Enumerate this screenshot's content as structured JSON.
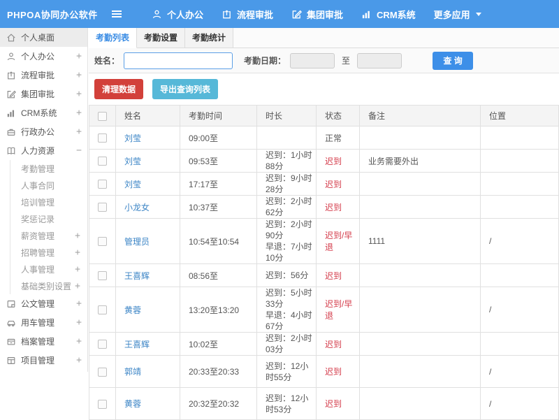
{
  "navbar": {
    "logo": "PHPOA协同办公软件",
    "items": [
      {
        "label": "个人办公",
        "icon": "user-icon"
      },
      {
        "label": "流程审批",
        "icon": "flow-icon"
      },
      {
        "label": "集团审批",
        "icon": "edit-icon"
      },
      {
        "label": "CRM系统",
        "icon": "chart-icon"
      },
      {
        "label": "更多应用",
        "icon": "caret-down-icon"
      }
    ]
  },
  "sidebar": {
    "items": [
      {
        "label": "个人桌面",
        "expand": "",
        "icon": "home-icon"
      },
      {
        "label": "个人办公",
        "expand": "+",
        "icon": "user-icon"
      },
      {
        "label": "流程审批",
        "expand": "+",
        "icon": "flow-icon"
      },
      {
        "label": "集团审批",
        "expand": "+",
        "icon": "edit-icon"
      },
      {
        "label": "CRM系统",
        "expand": "+",
        "icon": "chart-icon"
      },
      {
        "label": "行政办公",
        "expand": "+",
        "icon": "briefcase-icon"
      },
      {
        "label": "人力资源",
        "expand": "−",
        "icon": "book-icon"
      }
    ],
    "hr_children": [
      {
        "label": "考勤管理",
        "expand": ""
      },
      {
        "label": "人事合同",
        "expand": ""
      },
      {
        "label": "培训管理",
        "expand": ""
      },
      {
        "label": "奖惩记录",
        "expand": ""
      },
      {
        "label": "薪资管理",
        "expand": "+"
      },
      {
        "label": "招聘管理",
        "expand": "+"
      },
      {
        "label": "人事管理",
        "expand": "+"
      },
      {
        "label": "基础类别设置",
        "expand": "+"
      }
    ],
    "items_after": [
      {
        "label": "公文管理",
        "expand": "+",
        "icon": "doc-icon"
      },
      {
        "label": "用车管理",
        "expand": "+",
        "icon": "car-icon"
      },
      {
        "label": "档案管理",
        "expand": "+",
        "icon": "archive-icon"
      },
      {
        "label": "项目管理",
        "expand": "+",
        "icon": "project-icon"
      }
    ]
  },
  "tabs": [
    {
      "label": "考勤列表",
      "active": true
    },
    {
      "label": "考勤设置",
      "active": false
    },
    {
      "label": "考勤统计",
      "active": false
    }
  ],
  "search": {
    "name_label": "姓名：",
    "name_value": "",
    "date_label": "考勤日期：",
    "date_from": "",
    "to_label": "至",
    "date_to": "",
    "search_button": "查 询"
  },
  "actions": {
    "clean_button": "清理数据",
    "export_button": "导出查询列表"
  },
  "table": {
    "headers": [
      "姓名",
      "考勤时间",
      "时长",
      "状态",
      "备注",
      "位置"
    ],
    "rows": [
      {
        "name": "刘莹",
        "time": "09:00至",
        "d1": "",
        "d2": "",
        "status": "正常",
        "kind": "ok",
        "note": "",
        "loc": ""
      },
      {
        "name": "刘莹",
        "time": "09:53至",
        "d1": "迟到：1小时88分",
        "d2": "",
        "status": "迟到",
        "kind": "late",
        "note": "业务需要外出",
        "loc": ""
      },
      {
        "name": "刘莹",
        "time": "17:17至",
        "d1": "迟到：9小时28分",
        "d2": "",
        "status": "迟到",
        "kind": "late",
        "note": "",
        "loc": ""
      },
      {
        "name": "小龙女",
        "time": "10:37至",
        "d1": "迟到：2小时62分",
        "d2": "",
        "status": "迟到",
        "kind": "late",
        "note": "",
        "loc": ""
      },
      {
        "name": "管理员",
        "time": "10:54至10:54",
        "d1": "迟到：2小时90分",
        "d2": "早退：7小时10分",
        "status": "迟到/早退",
        "kind": "late",
        "note": "1111",
        "loc": "/"
      },
      {
        "name": "王喜辉",
        "time": "08:56至",
        "d1": "迟到：56分",
        "d2": "",
        "status": "迟到",
        "kind": "late",
        "note": "",
        "loc": ""
      },
      {
        "name": "黄蓉",
        "time": "13:20至13:20",
        "d1": "迟到：5小时33分",
        "d2": "早退：4小时67分",
        "status": "迟到/早退",
        "kind": "late",
        "note": "",
        "loc": "/"
      },
      {
        "name": "王喜辉",
        "time": "10:02至",
        "d1": "迟到：2小时03分",
        "d2": "",
        "status": "迟到",
        "kind": "late",
        "note": "",
        "loc": ""
      },
      {
        "name": "郭靖",
        "time": "20:33至20:33",
        "d1": "迟到：12小时55分",
        "d2": "",
        "status": "迟到",
        "kind": "late",
        "note": "",
        "loc": "/"
      },
      {
        "name": "黄蓉",
        "time": "20:32至20:32",
        "d1": "迟到：12小时53分",
        "d2": "",
        "status": "迟到",
        "kind": "late",
        "note": "",
        "loc": "/"
      }
    ]
  },
  "colors": {
    "navbar_blue": "#4a99e8",
    "accent_blue": "#3a8ce4",
    "search_button_blue": "#3d8fe8",
    "danger_red": "#d2403a",
    "info_cyan": "#56b8d8",
    "status_red": "#d43b4a",
    "link_blue": "#3c85c6"
  }
}
